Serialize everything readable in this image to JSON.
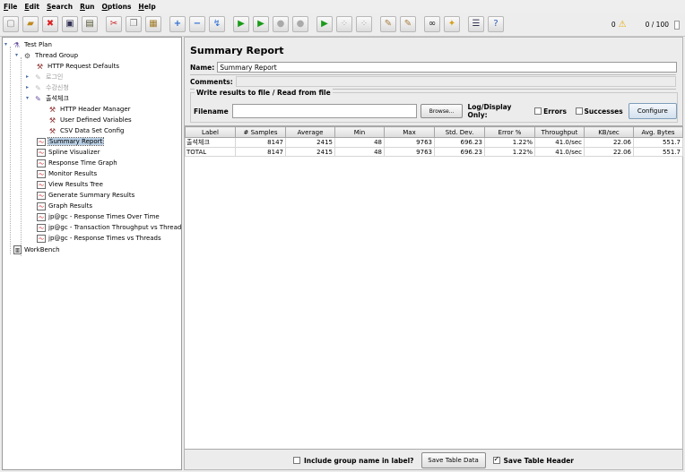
{
  "menu": [
    {
      "u": "F",
      "rest": "ile"
    },
    {
      "u": "E",
      "rest": "dit"
    },
    {
      "u": "S",
      "rest": "earch"
    },
    {
      "u": "R",
      "rest": "un"
    },
    {
      "u": "O",
      "rest": "ptions"
    },
    {
      "u": "H",
      "rest": "elp"
    }
  ],
  "toolbar": {
    "icons": [
      "new-icon",
      "open-icon",
      "close-icon",
      "save-icon",
      "save-as-icon",
      "cut-icon",
      "copy-icon",
      "paste-icon",
      "expand-icon",
      "collapse-icon",
      "toggle-icon",
      "start-icon",
      "start-no-pause-icon",
      "stop-icon",
      "shutdown-icon",
      "remote-start-icon",
      "remote-stop-icon",
      "remote-shutdown-icon",
      "clear-icon",
      "clear-all-icon",
      "search-icon",
      "reset-search-icon",
      "function-helper-icon",
      "help-icon"
    ],
    "warning_count": "0",
    "threads": "0 / 100"
  },
  "tree": {
    "test_plan": "Test Plan",
    "thread_group": "Thread Group",
    "http_defaults": "HTTP Request Defaults",
    "login": "로그인",
    "course": "수강신청",
    "checkin": "출석체크",
    "header_manager": "HTTP Header Manager",
    "user_vars": "User Defined Variables",
    "csv_config": "CSV Data Set Config",
    "listeners": [
      "Summary Report",
      "Spline Visualizer",
      "Response Time Graph",
      "Monitor Results",
      "View Results Tree",
      "Generate Summary Results",
      "Graph Results",
      "jp@gc - Response Times Over Time",
      "jp@gc - Transaction Throughput vs Threads",
      "jp@gc - Response Times vs Threads"
    ],
    "workbench": "WorkBench"
  },
  "panel": {
    "title": "Summary Report",
    "name_label": "Name:",
    "name_value": "Summary Report",
    "comments_label": "Comments:",
    "file_section": "Write results to file / Read from file",
    "filename_label": "Filename",
    "filename_value": "",
    "browse": "Browse...",
    "log_display": "Log/Display Only:",
    "errors": "Errors",
    "successes": "Successes",
    "configure": "Configure"
  },
  "table": {
    "headers": [
      "Label",
      "# Samples",
      "Average",
      "Min",
      "Max",
      "Std. Dev.",
      "Error %",
      "Throughput",
      "KB/sec",
      "Avg. Bytes"
    ],
    "rows": [
      [
        "출석체크",
        "8147",
        "2415",
        "48",
        "9763",
        "696.23",
        "1.22%",
        "41.0/sec",
        "22.06",
        "551.7"
      ],
      [
        "TOTAL",
        "8147",
        "2415",
        "48",
        "9763",
        "696.23",
        "1.22%",
        "41.0/sec",
        "22.06",
        "551.7"
      ]
    ]
  },
  "bottom": {
    "include_group": "Include group name in label?",
    "save_table_data": "Save Table Data",
    "save_table_header": "Save Table Header",
    "save_table_header_checked": true
  }
}
